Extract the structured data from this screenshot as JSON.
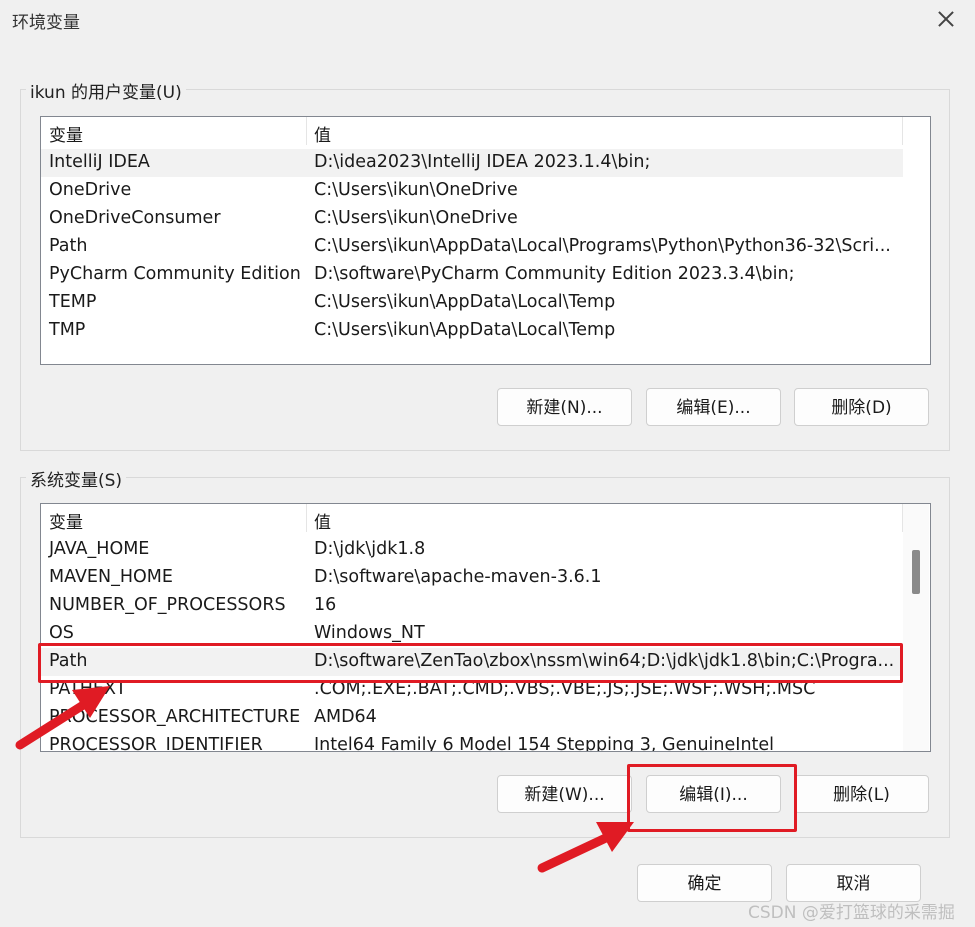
{
  "dialog": {
    "title": "环境变量",
    "ok_label": "确定",
    "cancel_label": "取消"
  },
  "user_vars": {
    "group_label": "ikun 的用户变量(U)",
    "col_name": "变量",
    "col_value": "值",
    "rows": [
      {
        "name": "IntelliJ IDEA",
        "value": "D:\\idea2023\\IntelliJ IDEA 2023.1.4\\bin;"
      },
      {
        "name": "OneDrive",
        "value": "C:\\Users\\ikun\\OneDrive"
      },
      {
        "name": "OneDriveConsumer",
        "value": "C:\\Users\\ikun\\OneDrive"
      },
      {
        "name": "Path",
        "value": "C:\\Users\\ikun\\AppData\\Local\\Programs\\Python\\Python36-32\\Scri..."
      },
      {
        "name": "PyCharm Community Edition",
        "value": "D:\\software\\PyCharm Community Edition 2023.3.4\\bin;"
      },
      {
        "name": "TEMP",
        "value": "C:\\Users\\ikun\\AppData\\Local\\Temp"
      },
      {
        "name": "TMP",
        "value": "C:\\Users\\ikun\\AppData\\Local\\Temp"
      }
    ],
    "new_label": "新建(N)...",
    "edit_label": "编辑(E)...",
    "delete_label": "删除(D)"
  },
  "system_vars": {
    "group_label": "系统变量(S)",
    "col_name": "变量",
    "col_value": "值",
    "rows": [
      {
        "name": "JAVA_HOME",
        "value": "D:\\jdk\\jdk1.8"
      },
      {
        "name": "MAVEN_HOME",
        "value": "D:\\software\\apache-maven-3.6.1"
      },
      {
        "name": "NUMBER_OF_PROCESSORS",
        "value": "16"
      },
      {
        "name": "OS",
        "value": "Windows_NT"
      },
      {
        "name": "Path",
        "value": "D:\\software\\ZenTao\\zbox\\nssm\\win64;D:\\jdk\\jdk1.8\\bin;C:\\Progra..."
      },
      {
        "name": "PATHEXT",
        "value": ".COM;.EXE;.BAT;.CMD;.VBS;.VBE;.JS;.JSE;.WSF;.WSH;.MSC"
      },
      {
        "name": "PROCESSOR_ARCHITECTURE",
        "value": "AMD64"
      },
      {
        "name": "PROCESSOR_IDENTIFIER",
        "value": "Intel64 Family 6 Model 154 Stepping 3, GenuineIntel"
      }
    ],
    "new_label": "新建(W)...",
    "edit_label": "编辑(I)...",
    "delete_label": "删除(L)"
  },
  "watermark": "CSDN @爱打篮球的采需掘",
  "colors": {
    "highlight_red": "#e01b24",
    "dialog_bg": "#f0f0f0"
  }
}
